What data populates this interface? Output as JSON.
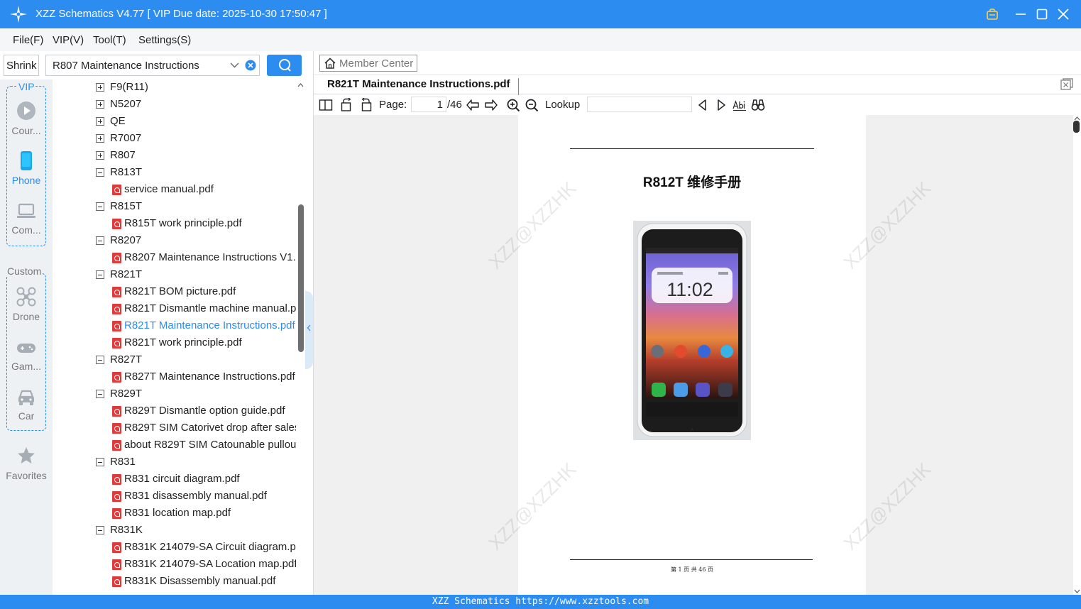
{
  "app": {
    "title": "XZZ Schematics V4.77 [ VIP Due date: 2025-10-30 17:50:47 ]",
    "accent": "#2d8cf0"
  },
  "menu": [
    "File(F)",
    "VIP(V)",
    "Tool(T)",
    "Settings(S)"
  ],
  "search": {
    "shrink_label": "Shrink",
    "value": "R807 Maintenance Instructions"
  },
  "rail": {
    "vip_label": "VIP",
    "vip_items": [
      {
        "label": "Cour...",
        "icon": "play-circle-icon"
      },
      {
        "label": "Phone",
        "icon": "phone-icon"
      },
      {
        "label": "Com...",
        "icon": "laptop-icon"
      }
    ],
    "custom_label": "Custom",
    "custom_items": [
      {
        "label": "Drone",
        "icon": "drone-icon"
      },
      {
        "label": "Gam...",
        "icon": "gamepad-icon"
      },
      {
        "label": "Car",
        "icon": "car-icon"
      }
    ],
    "favorites_label": "Favorites"
  },
  "tree": [
    {
      "type": "folder",
      "label": "F9(R11)",
      "expanded": false
    },
    {
      "type": "folder",
      "label": "N5207",
      "expanded": false
    },
    {
      "type": "folder",
      "label": "QE",
      "expanded": false
    },
    {
      "type": "folder",
      "label": "R7007",
      "expanded": false
    },
    {
      "type": "folder",
      "label": "R807",
      "expanded": false
    },
    {
      "type": "folder",
      "label": "R813T",
      "expanded": true
    },
    {
      "type": "file",
      "label": "service manual.pdf"
    },
    {
      "type": "folder",
      "label": "R815T",
      "expanded": true
    },
    {
      "type": "file",
      "label": "R815T work principle.pdf"
    },
    {
      "type": "folder",
      "label": "R8207",
      "expanded": true
    },
    {
      "type": "file",
      "label": "R8207 Maintenance Instructions V1.("
    },
    {
      "type": "folder",
      "label": "R821T",
      "expanded": true
    },
    {
      "type": "file",
      "label": "R821T BOM picture.pdf"
    },
    {
      "type": "file",
      "label": "R821T Dismantle machine manual.p"
    },
    {
      "type": "file",
      "label": "R821T Maintenance Instructions.pdf",
      "selected": true
    },
    {
      "type": "file",
      "label": "R821T work principle.pdf"
    },
    {
      "type": "folder",
      "label": "R827T",
      "expanded": true
    },
    {
      "type": "file",
      "label": "R827T Maintenance Instructions.pdf"
    },
    {
      "type": "folder",
      "label": "R829T",
      "expanded": true
    },
    {
      "type": "file",
      "label": "R829T Dismantle option guide.pdf"
    },
    {
      "type": "file",
      "label": "R829T SIM Catorivet drop after sales"
    },
    {
      "type": "file",
      "label": "about R829T SIM Catounable pullou"
    },
    {
      "type": "folder",
      "label": "R831",
      "expanded": true
    },
    {
      "type": "file",
      "label": "R831 circuit diagram.pdf"
    },
    {
      "type": "file",
      "label": "R831 disassembly manual.pdf"
    },
    {
      "type": "file",
      "label": "R831 location map.pdf"
    },
    {
      "type": "folder",
      "label": "R831K",
      "expanded": true
    },
    {
      "type": "file",
      "label": "R831K 214079-SA Circuit diagram.pc"
    },
    {
      "type": "file",
      "label": "R831K 214079-SA Location map.pdf"
    },
    {
      "type": "file",
      "label": "R831K Disassembly manual.pdf"
    }
  ],
  "viewer": {
    "member_center_label": "Member Center",
    "tab_label": "R821T Maintenance Instructions.pdf",
    "page_label": "Page:",
    "page_current": "1",
    "page_total": "/46",
    "lookup_label": "Lookup",
    "lookup_value": ""
  },
  "document": {
    "title": "R812T 维修手册",
    "phone_time": "11:02",
    "footer": "第 1 页 共 46 页",
    "watermark": "XZZ@XZZHK"
  },
  "status": {
    "text": "XZZ Schematics https://www.xzztools.com"
  }
}
